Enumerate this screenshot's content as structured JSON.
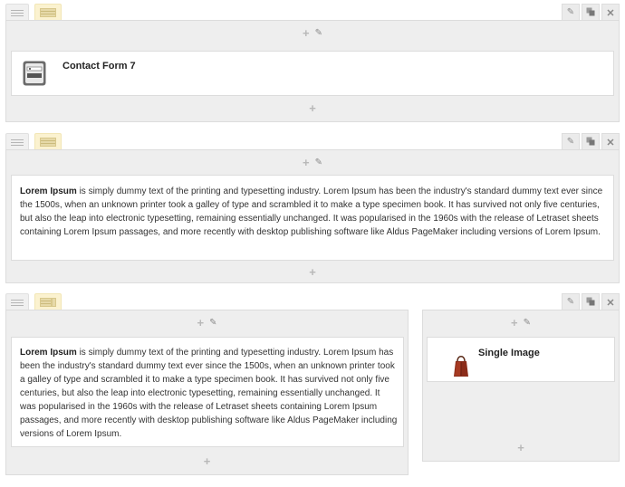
{
  "icons": {
    "drag": "drag-handle-icon",
    "layout": "column-layout-icon",
    "edit": "pencil-icon",
    "duplicate": "duplicate-icon",
    "delete": "close-icon",
    "add": "plus-icon",
    "contact_form": "contact-form-icon",
    "image": "handbag-image-icon"
  },
  "rows": [
    {
      "widgets": [
        {
          "title": "Contact Form 7"
        }
      ]
    },
    {
      "widgets": [
        {
          "bold_lead": "Lorem Ipsum",
          "text": " is simply dummy text of the printing and typesetting industry. Lorem Ipsum has been the industry's standard dummy text ever since the 1500s, when an unknown printer took a galley of type and scrambled it to make a type specimen book. It has survived not only five centuries, but also the leap into electronic typesetting, remaining essentially unchanged. It was popularised in the 1960s with the release of Letraset sheets containing Lorem Ipsum passages, and more recently with desktop publishing software like Aldus PageMaker including versions of Lorem Ipsum."
        }
      ]
    },
    {
      "widgets": [
        {
          "bold_lead": "Lorem Ipsum",
          "text": " is simply dummy text of the printing and typesetting industry. Lorem Ipsum has been the industry's standard dummy text ever since the 1500s, when an unknown printer took a galley of type and scrambled it to make a type specimen book. It has survived not only five centuries, but also the leap into electronic typesetting, remaining essentially unchanged. It was popularised in the 1960s with the release of Letraset sheets containing Lorem Ipsum passages, and more recently with desktop publishing software like Aldus PageMaker including versions of Lorem Ipsum."
        },
        {
          "title": "Single Image"
        }
      ]
    }
  ],
  "colors": {
    "layout_button": "#fbf2d0",
    "column_bg": "#eeeeee",
    "widget_bg": "#ffffff"
  }
}
